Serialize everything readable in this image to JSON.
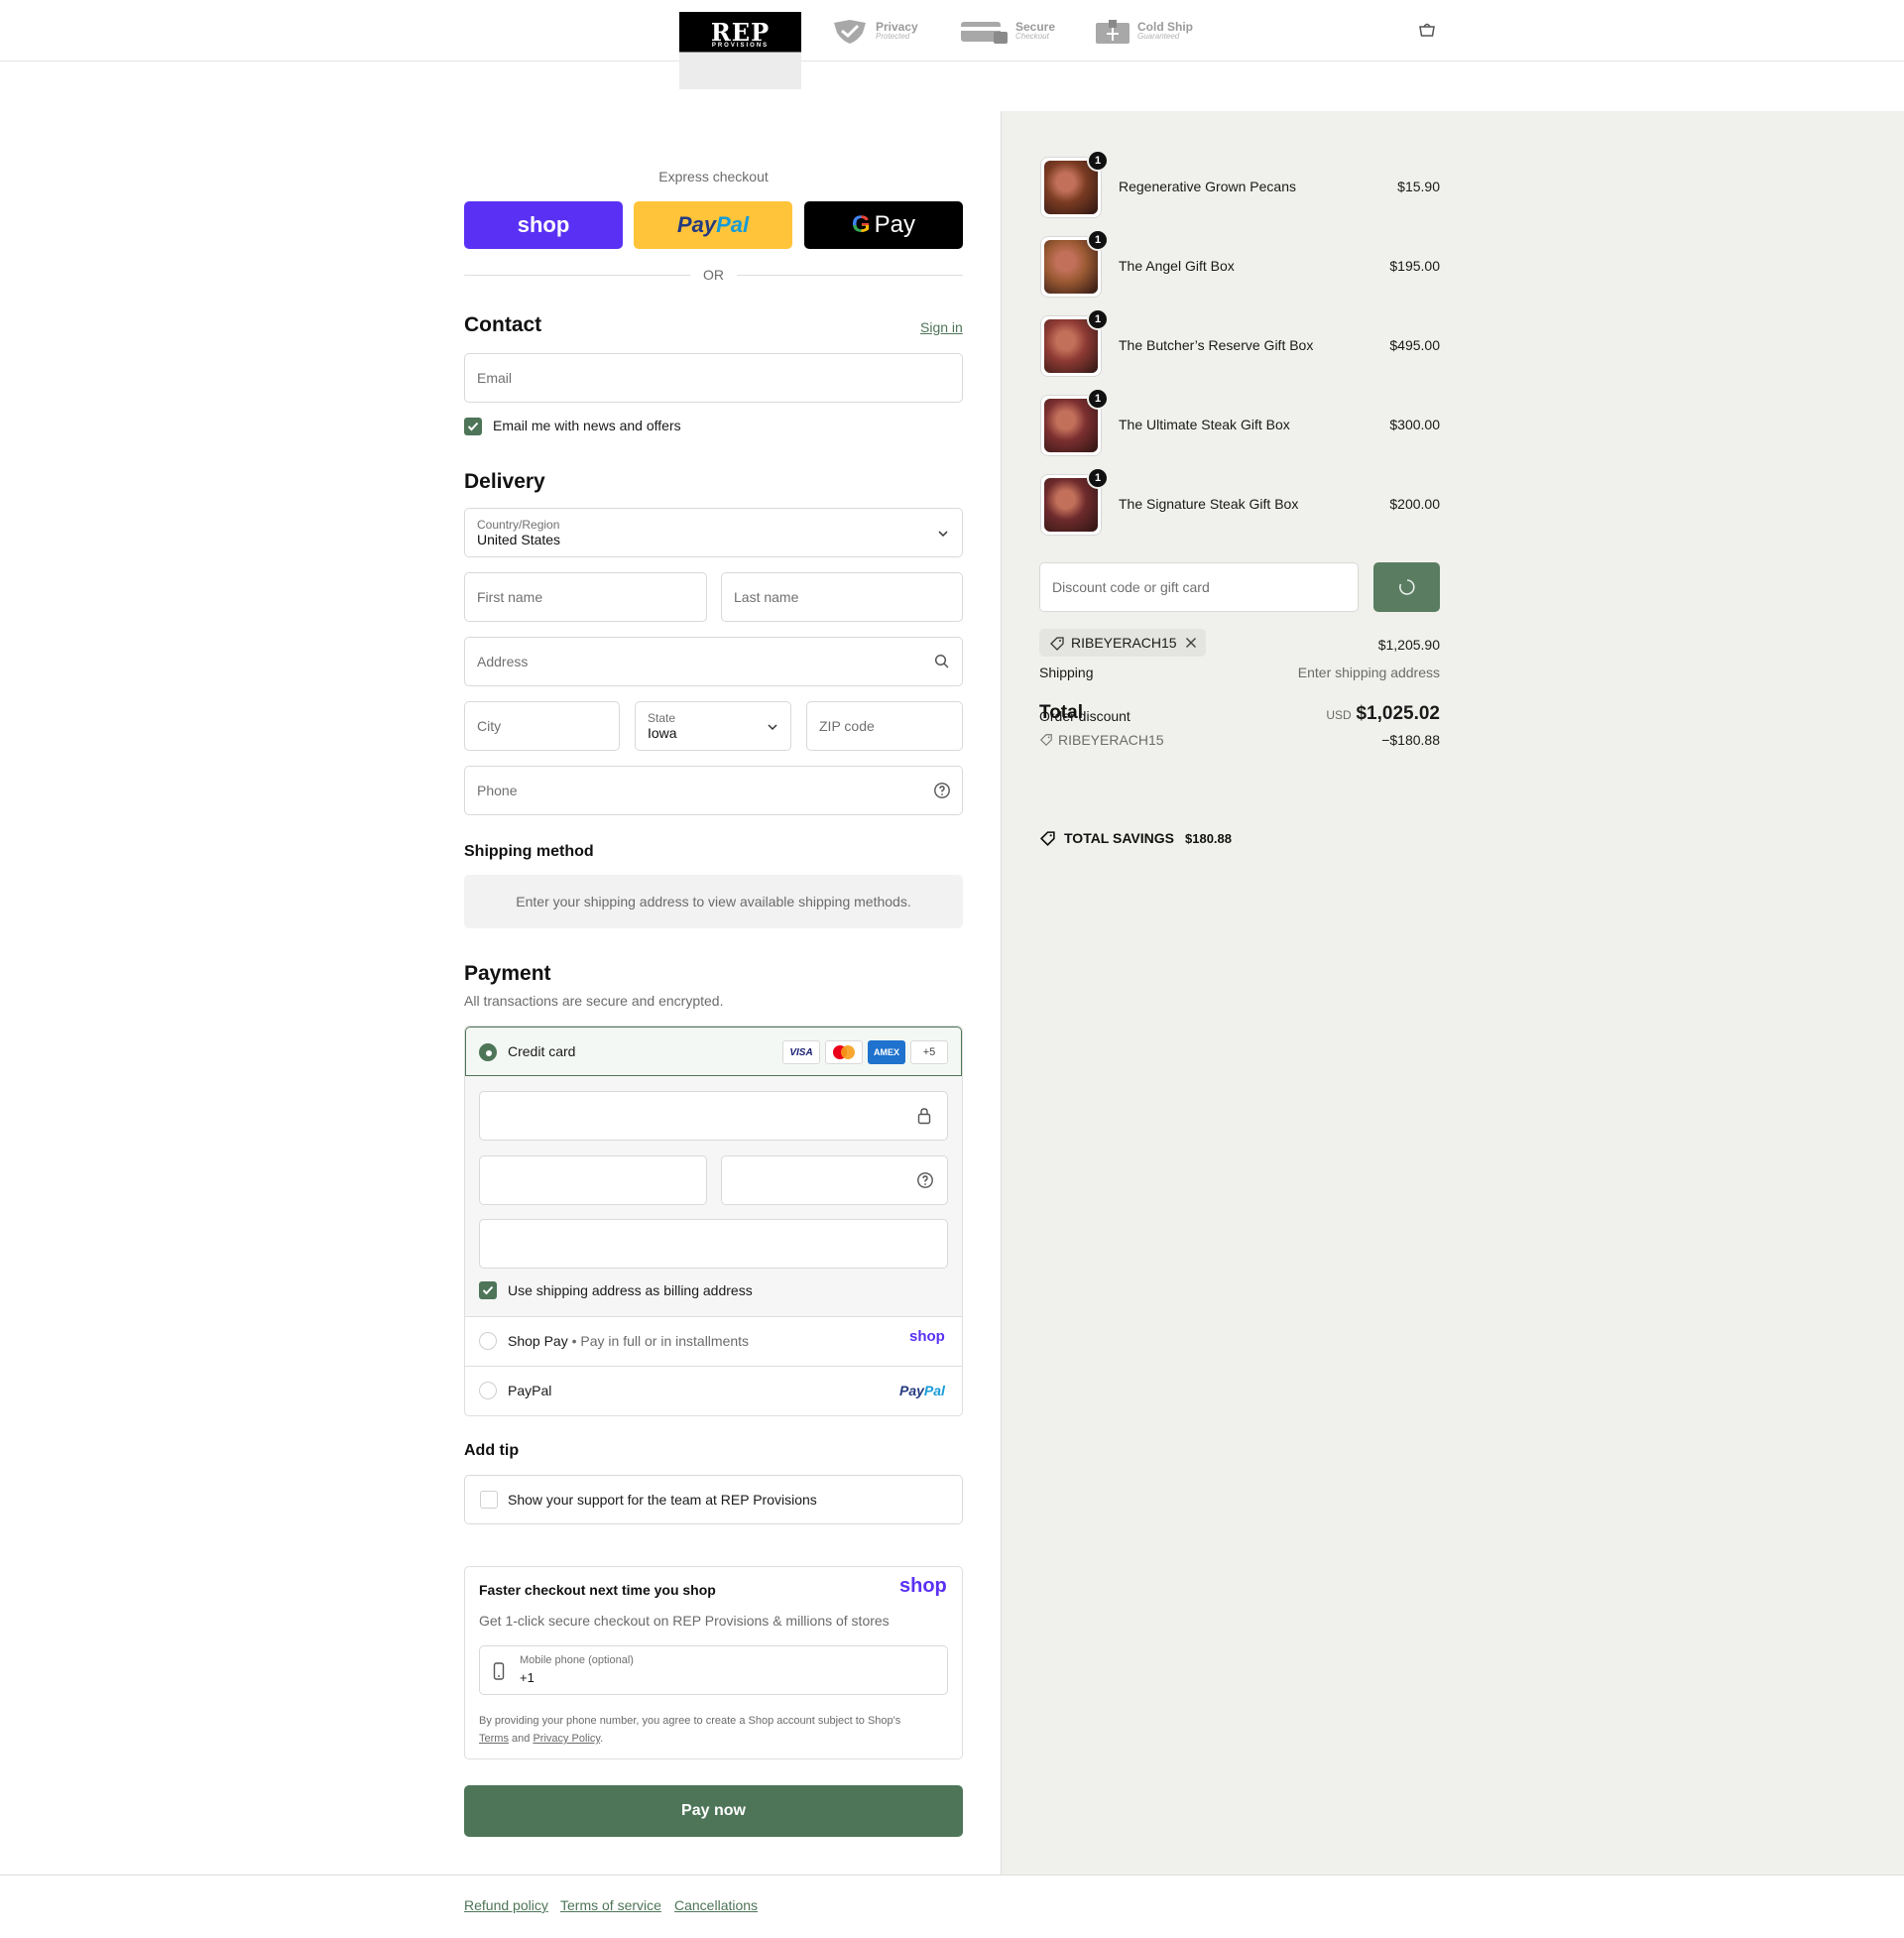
{
  "header": {
    "logo_text": "REP",
    "logo_sub": "PROVISIONS",
    "badges": [
      {
        "title": "Privacy",
        "sub": "Protected",
        "icon": "shield-check-icon"
      },
      {
        "title": "Secure",
        "sub": "Checkout",
        "icon": "credit-card-lock-icon"
      },
      {
        "title": "Cold Ship",
        "sub": "Guaranteed",
        "icon": "cold-box-icon"
      }
    ],
    "cart_icon": "shopping-bag-icon"
  },
  "express": {
    "title": "Express checkout",
    "shop_label": "shop",
    "paypal_label_a": "Pay",
    "paypal_label_b": "Pal",
    "gpay_label": "Pay",
    "or_label": "OR"
  },
  "contact": {
    "title": "Contact",
    "sign_in": "Sign in",
    "email_placeholder": "Email",
    "news_label": "Email me with news and offers"
  },
  "delivery": {
    "title": "Delivery",
    "country_label": "Country/Region",
    "country_value": "United States",
    "first_name": "First name",
    "last_name": "Last name",
    "address": "Address",
    "city": "City",
    "state_label": "State",
    "state_value": "Iowa",
    "zip": "ZIP code",
    "phone": "Phone"
  },
  "shipping_method": {
    "title": "Shipping method",
    "notice": "Enter your shipping address to view available shipping methods."
  },
  "payment": {
    "title": "Payment",
    "subtitle": "All transactions are secure and encrypted.",
    "credit_card": "Credit card",
    "card_brands": [
      "VISA",
      "Mastercard",
      "AMEX",
      "+5"
    ],
    "billing_label": "Use shipping address as billing address",
    "shop_pay": "Shop Pay",
    "shop_pay_note": "Pay in full or in installments",
    "shop_pay_logo": "shop",
    "paypal": "PayPal",
    "paypal_logo_a": "Pay",
    "paypal_logo_b": "Pal"
  },
  "tip": {
    "title": "Add tip",
    "label": "Show your support for the team at REP Provisions"
  },
  "shop_promo": {
    "title": "Faster checkout next time you shop",
    "logo": "shop",
    "text": "Get 1-click secure checkout on REP Provisions & millions of stores",
    "phone_label": "Mobile phone (optional)",
    "phone_value": "+1",
    "legal_a": "By providing your phone number, you agree to create a Shop account subject to Shop's",
    "terms": "Terms",
    "and": "and",
    "privacy": "Privacy Policy",
    "period": "."
  },
  "pay_now": "Pay now",
  "order": {
    "items": [
      {
        "name": "Regenerative Grown Pecans",
        "price": "$15.90",
        "qty": "1",
        "color": "#7a3b22"
      },
      {
        "name": "The Angel Gift Box",
        "price": "$195.00",
        "qty": "1",
        "color": "#9b5a33"
      },
      {
        "name": "The Butcher’s Reserve Gift Box",
        "price": "$495.00",
        "qty": "1",
        "color": "#8e3a34"
      },
      {
        "name": "The Ultimate Steak Gift Box",
        "price": "$300.00",
        "qty": "1",
        "color": "#7c2f30"
      },
      {
        "name": "The Signature Steak Gift Box",
        "price": "$200.00",
        "qty": "1",
        "color": "#6e2a2c"
      }
    ],
    "discount_placeholder": "Discount code or gift card",
    "applied_code": "RIBEYERACH15",
    "subtotal_value": "$1,205.90",
    "shipping_label": "Shipping",
    "shipping_value": "Enter shipping address",
    "total_label": "Total",
    "order_discount_label": "Order discount",
    "currency": "USD",
    "total_value": "$1,025.02",
    "discount_code": "RIBEYERACH15",
    "discount_value": "−$180.88",
    "savings_label": "TOTAL SAVINGS",
    "savings_value": "$180.88"
  },
  "footer": {
    "links": [
      "Refund policy",
      "Terms of service",
      "Cancellations"
    ]
  },
  "colors": {
    "accent": "#4e7558",
    "shop": "#5a31f4",
    "paypal_bg": "#ffc439",
    "summary_bg": "#f0f0ec"
  }
}
